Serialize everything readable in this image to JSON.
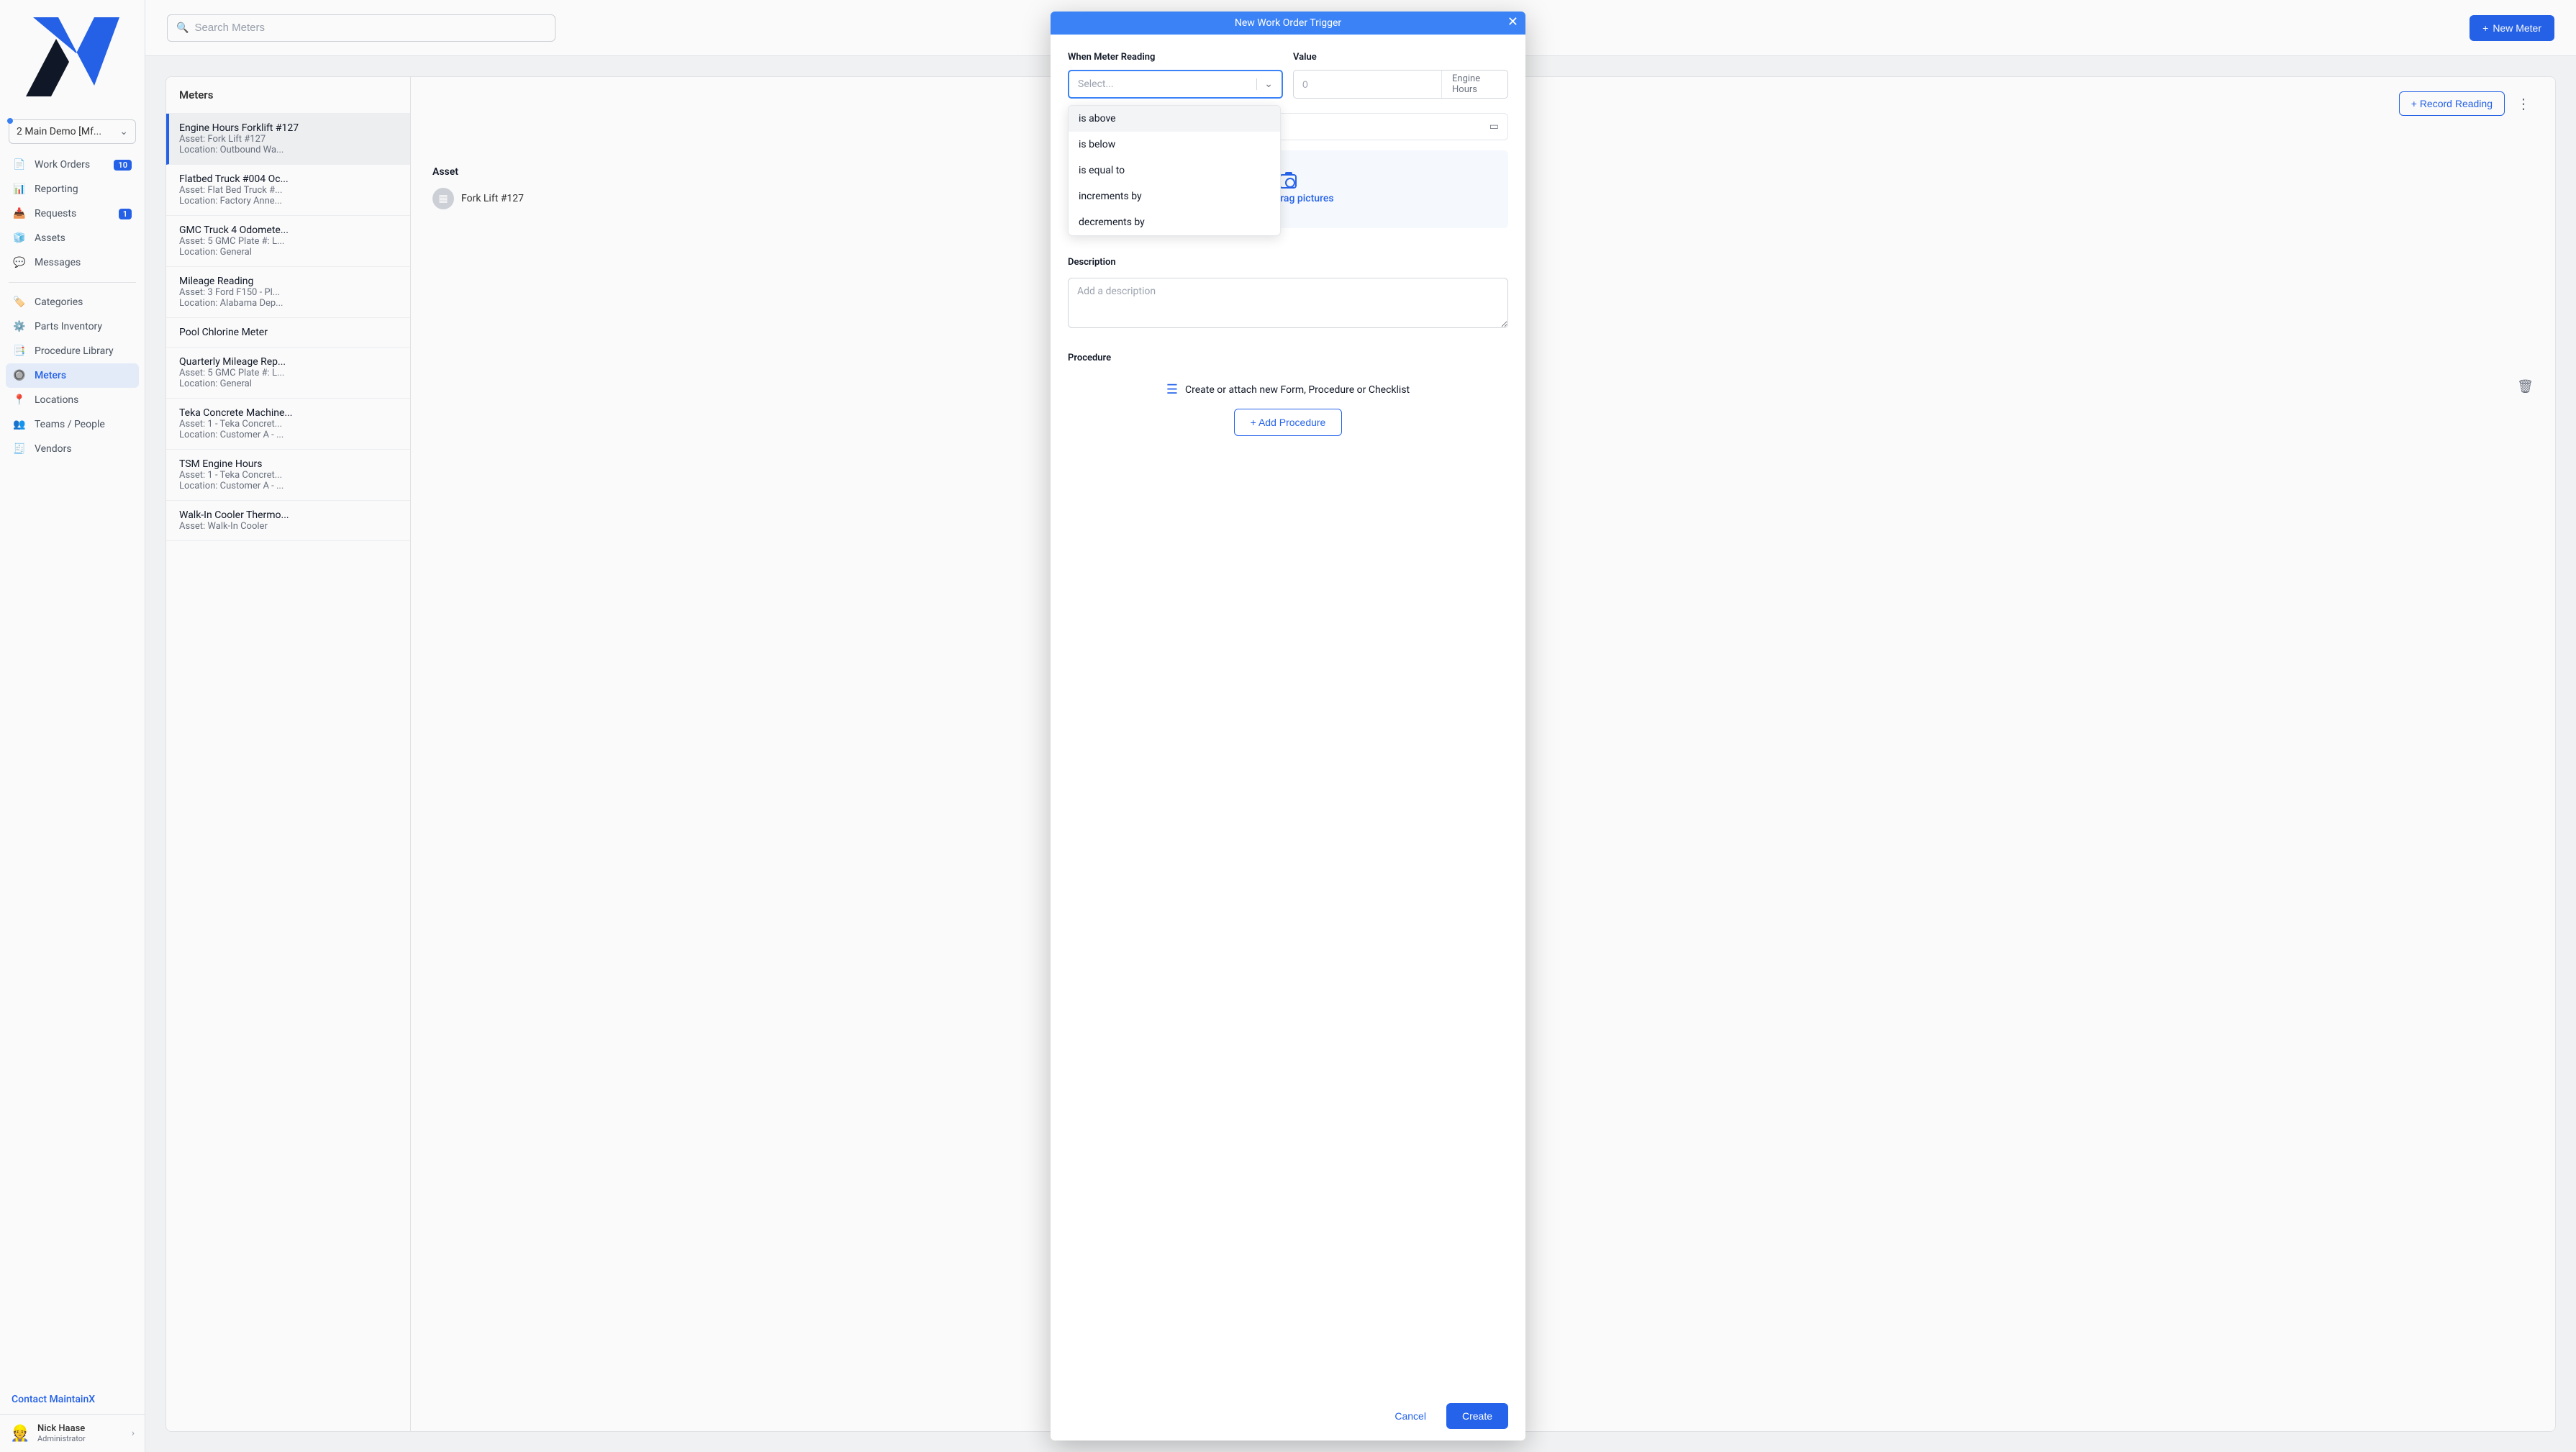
{
  "sidebar": {
    "demo_label": "2 Main Demo [Mf...",
    "nav": [
      {
        "icon": "📄",
        "label": "Work Orders",
        "badge": "10",
        "active": false,
        "name": "nav-work-orders"
      },
      {
        "icon": "📊",
        "label": "Reporting",
        "badge": null,
        "active": false,
        "name": "nav-reporting"
      },
      {
        "icon": "📥",
        "label": "Requests",
        "badge": "1",
        "active": false,
        "name": "nav-requests"
      },
      {
        "icon": "🧊",
        "label": "Assets",
        "badge": null,
        "active": false,
        "name": "nav-assets"
      },
      {
        "icon": "💬",
        "label": "Messages",
        "badge": null,
        "active": false,
        "name": "nav-messages"
      }
    ],
    "nav2": [
      {
        "icon": "🏷️",
        "label": "Categories",
        "name": "nav-categories"
      },
      {
        "icon": "⚙️",
        "label": "Parts Inventory",
        "name": "nav-parts-inventory"
      },
      {
        "icon": "📑",
        "label": "Procedure Library",
        "name": "nav-procedure-library"
      },
      {
        "icon": "🔘",
        "label": "Meters",
        "name": "nav-meters",
        "active": true
      },
      {
        "icon": "📍",
        "label": "Locations",
        "name": "nav-locations"
      },
      {
        "icon": "👥",
        "label": "Teams / People",
        "name": "nav-teams"
      },
      {
        "icon": "🧾",
        "label": "Vendors",
        "name": "nav-vendors"
      }
    ],
    "contact": "Contact MaintainX",
    "user": {
      "name": "Nick Haase",
      "role": "Administrator"
    }
  },
  "topbar": {
    "search_placeholder": "Search Meters",
    "new_meter": "New Meter"
  },
  "list": {
    "header": "Meters",
    "items": [
      {
        "title": "Engine Hours Forklift #127",
        "sub1": "Asset: Fork Lift #127",
        "sub2": "Location: Outbound Wa...",
        "selected": true
      },
      {
        "title": "Flatbed Truck #004 Oc...",
        "sub1": "Asset: Flat Bed Truck #...",
        "sub2": "Location: Factory Anne..."
      },
      {
        "title": "GMC Truck 4 Odomete...",
        "sub1": "Asset: 5 GMC Plate #: L...",
        "sub2": "Location: General"
      },
      {
        "title": "Mileage Reading",
        "sub1": "Asset: 3 Ford F150 - Pl...",
        "sub2": "Location: Alabama Dep..."
      },
      {
        "title": "Pool Chlorine Meter",
        "sub1": "",
        "sub2": ""
      },
      {
        "title": "Quarterly Mileage Rep...",
        "sub1": "Asset: 5 GMC Plate #: L...",
        "sub2": "Location: General"
      },
      {
        "title": "Teka Concrete Machine...",
        "sub1": "Asset: 1 - Teka Concret...",
        "sub2": "Location: Customer A - ..."
      },
      {
        "title": "TSM Engine Hours",
        "sub1": "Asset: 1 - Teka Concret...",
        "sub2": "Location: Customer A - ..."
      },
      {
        "title": "Walk-In Cooler Thermo...",
        "sub1": "Asset: Walk-In Cooler",
        "sub2": ""
      }
    ]
  },
  "detail": {
    "record_btn": "+ Record Reading",
    "asset_label": "Asset",
    "asset_value": "Fork Lift #127"
  },
  "modal": {
    "title": "New Work Order Trigger",
    "when_label": "When Meter Reading",
    "when_placeholder": "Select...",
    "value_label": "Value",
    "value_placeholder": "0",
    "value_unit": "Engine Hours",
    "dropzone_text": "Add or drag pictures",
    "description_label": "Description",
    "description_placeholder": "Add a description",
    "procedure_label": "Procedure",
    "procedure_hint": "Create or attach new Form, Procedure or Checklist",
    "add_procedure_btn": "+  Add Procedure",
    "cancel": "Cancel",
    "create": "Create",
    "dropdown_options": [
      "is above",
      "is below",
      "is equal to",
      "increments by",
      "decrements by"
    ]
  }
}
